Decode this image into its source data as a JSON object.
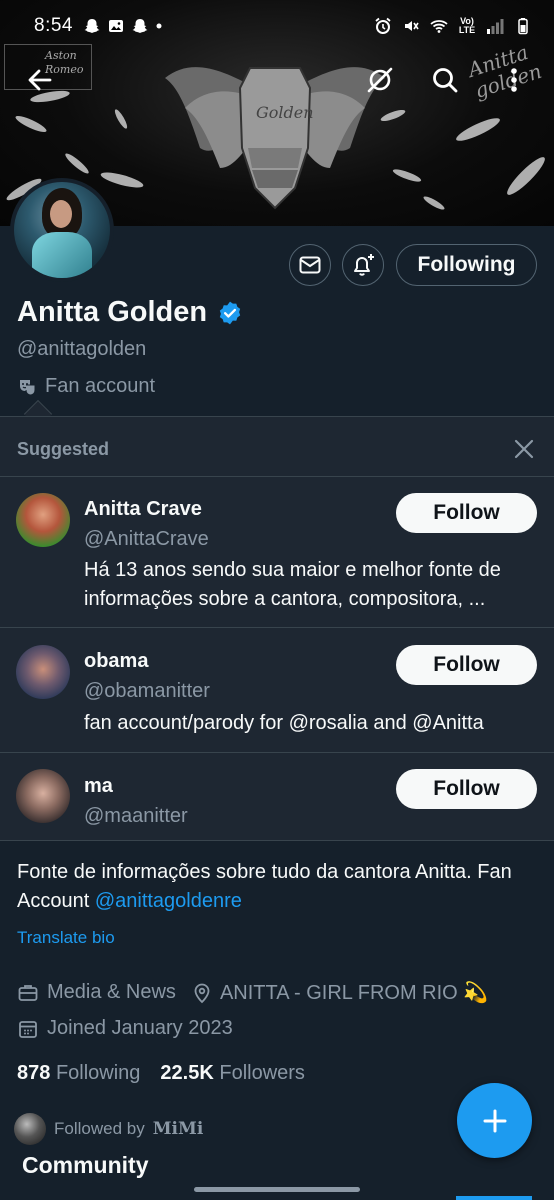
{
  "status_bar": {
    "time": "8:54",
    "notification_icons": [
      "snapchat-icon",
      "image-icon",
      "snapchat-icon",
      "dot-icon"
    ],
    "system_icons": [
      "alarm-icon",
      "mute-icon",
      "wifi-icon",
      "volte-icon",
      "signal-icon",
      "battery-icon"
    ],
    "volte_label": "Vo) LTE"
  },
  "banner": {
    "left_logo_text": "Aston Romeo",
    "signature_text": "Anitta golden",
    "armor_text": "Golden"
  },
  "nav": {
    "back_icon": "arrow-left-icon",
    "grok_icon": "grok-icon",
    "search_icon": "search-icon",
    "more_icon": "more-vertical-icon"
  },
  "actions": {
    "message_icon": "mail-icon",
    "notify_icon": "bell-plus-icon",
    "following_label": "Following"
  },
  "profile": {
    "name": "Anitta Golden",
    "verified": true,
    "handle": "@anittagolden",
    "account_label": "Fan account",
    "bio_text": "Fonte de informações sobre tudo da cantora Anitta. Fan Account ",
    "bio_mention": "@anittagoldenre",
    "translate_label": "Translate bio",
    "category": "Media & News",
    "location": "ANITTA - GIRL FROM RIO 💫",
    "joined": "Joined January 2023",
    "following_count": "878",
    "following_label": "Following",
    "followers_count": "22.5K",
    "followers_label": "Followers",
    "followed_by_prefix": "Followed by",
    "followed_by_name": "𝐌𝐢𝐌𝐢",
    "community_heading": "Community"
  },
  "suggested": {
    "heading": "Suggested",
    "close_icon": "close-icon",
    "follow_label": "Follow",
    "items": [
      {
        "name": "Anitta Crave",
        "handle": "@AnittaCrave",
        "bio": "Há 13 anos sendo sua maior e melhor fonte de informações sobre a cantora, compositora, ..."
      },
      {
        "name": "obama",
        "handle": "@obamanitter",
        "bio": "fan account/parody for @rosalia and @Anitta"
      },
      {
        "name": "ma",
        "handle": "@maanitter",
        "bio": ""
      }
    ]
  },
  "colors": {
    "background": "#15202b",
    "panel": "#1e2732",
    "accent": "#1d9bf0",
    "muted": "#8b98a5",
    "border": "#38444d"
  },
  "fab_icon": "plus-icon"
}
